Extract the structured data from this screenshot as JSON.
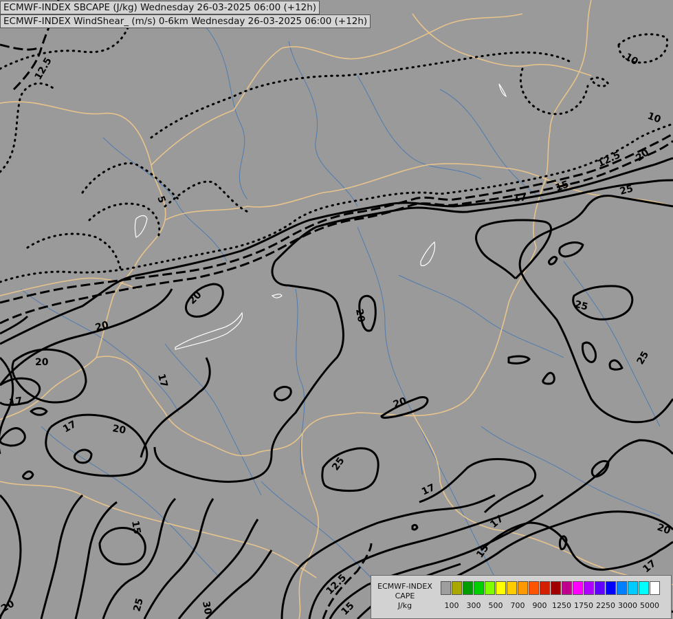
{
  "header": {
    "line1": "ECMWF-INDEX SBCAPE (J/kg) Wednesday 26-03-2025 06:00 (+12h)",
    "line2": "ECMWF-INDEX WindShear_ (m/s) 0-6km Wednesday 26-03-2025 06:00 (+12h)"
  },
  "legend": {
    "line1": "ECMWF-INDEX",
    "line2": "CAPE",
    "line3": "J/kg",
    "colors": [
      "#9e9e9e",
      "#a8a800",
      "#009c00",
      "#00d000",
      "#80ff00",
      "#ffff00",
      "#ffcc00",
      "#ff9900",
      "#ff5500",
      "#d42000",
      "#a00000",
      "#c0008c",
      "#ff00ff",
      "#b000ff",
      "#6000ff",
      "#0000ff",
      "#0080ff",
      "#00ccff",
      "#00ffff",
      "#ffffff"
    ],
    "ticks": [
      "100",
      "300",
      "500",
      "700",
      "900",
      "1250",
      "1750",
      "2250",
      "3000",
      "5000"
    ]
  },
  "contour_labels": [
    "12.5",
    "10",
    "10",
    "12.5",
    "20",
    "15",
    "25",
    "17",
    "5",
    "20",
    "20",
    "20",
    "25",
    "17",
    "17",
    "20",
    "17",
    "20",
    "25",
    "25",
    "17",
    "20",
    "15",
    "15",
    "17",
    "12.5",
    "15",
    "20",
    "25",
    "30",
    "20",
    "17"
  ],
  "colors": {
    "background": "#9a9a9a",
    "borders": "#e8c48c",
    "rivers": "#4f7bb0",
    "contours": "#000000",
    "lakes": "#ffffff"
  }
}
